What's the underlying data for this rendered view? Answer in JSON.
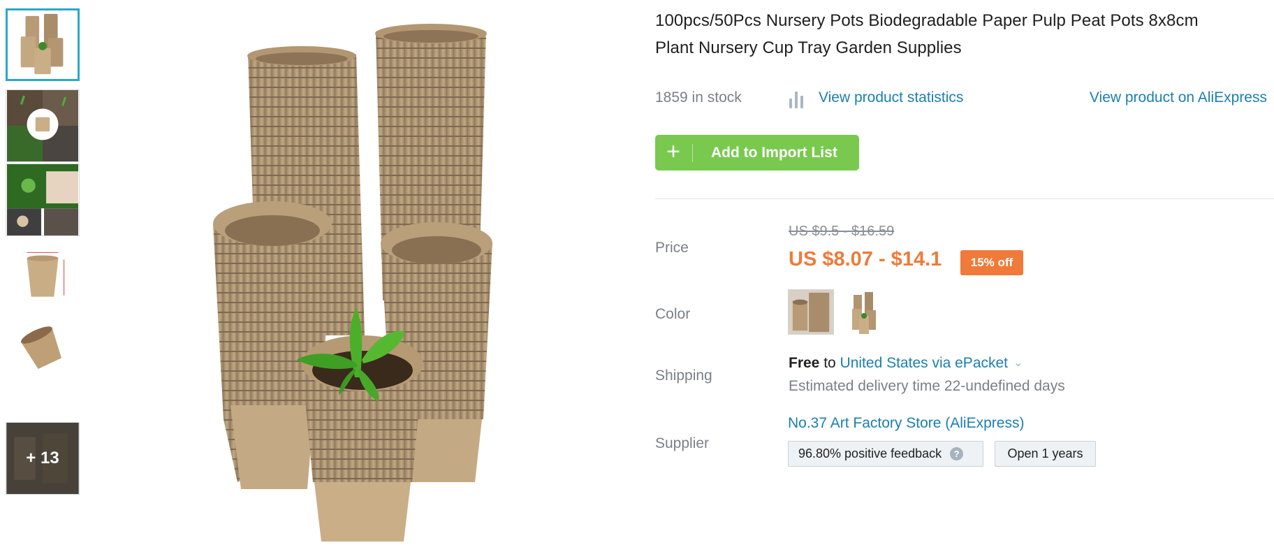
{
  "product": {
    "title_line1": "100pcs/50Pcs Nursery Pots Biodegradable Paper Pulp Peat Pots 8x8cm",
    "title_line2": "Plant Nursery Cup Tray Garden Supplies",
    "stock": "1859 in stock",
    "view_stats": "View product statistics",
    "view_aliexpress": "View product on AliExpress"
  },
  "actions": {
    "add_plus": "+",
    "add_label": "Add to Import List"
  },
  "gallery": {
    "more_label": "+ 13"
  },
  "price": {
    "label": "Price",
    "original": "US $9.5 - $16.59",
    "current": "US $8.07 - $14.1",
    "discount": "15% off"
  },
  "color": {
    "label": "Color"
  },
  "shipping": {
    "label": "Shipping",
    "free": "Free",
    "to": " to ",
    "destination": "United States via ePacket",
    "chevron": "⌄",
    "delivery": "Estimated delivery time 22-undefined days"
  },
  "supplier": {
    "label": "Supplier",
    "name": "No.37 Art Factory Store (AliExpress)",
    "feedback": "96.80% positive feedback",
    "help": "?",
    "open": "Open 1 years"
  },
  "colors": {
    "accent": "#2aa8c8",
    "link": "#1b7fb0",
    "button": "#79c94f",
    "price": "#f07a3a"
  }
}
